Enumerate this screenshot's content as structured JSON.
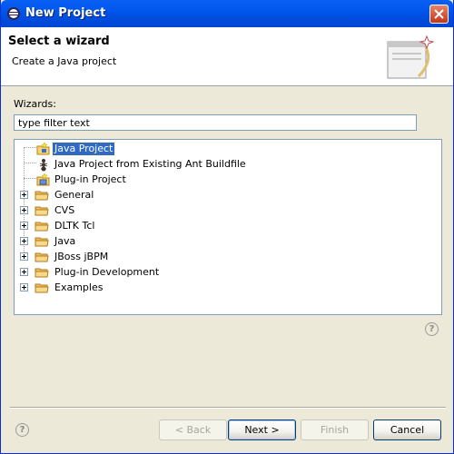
{
  "window": {
    "title": "New Project"
  },
  "header": {
    "title": "Select a wizard",
    "description": "Create a Java project"
  },
  "wizards": {
    "label": "Wizards:",
    "filter_value": "type filter text"
  },
  "tree": {
    "items": [
      {
        "label": "Java Project",
        "icon": "java-project-icon",
        "selected": true,
        "child": true
      },
      {
        "label": "Java Project from Existing Ant Buildfile",
        "icon": "ant-icon",
        "child": true
      },
      {
        "label": "Plug-in Project",
        "icon": "plugin-project-icon",
        "child": true
      },
      {
        "label": "General",
        "icon": "folder-icon"
      },
      {
        "label": "CVS",
        "icon": "folder-icon"
      },
      {
        "label": "DLTK Tcl",
        "icon": "folder-icon"
      },
      {
        "label": "Java",
        "icon": "folder-icon"
      },
      {
        "label": "JBoss jBPM",
        "icon": "folder-icon"
      },
      {
        "label": "Plug-in Development",
        "icon": "folder-icon"
      },
      {
        "label": "Examples",
        "icon": "folder-icon"
      }
    ]
  },
  "buttons": {
    "back": "< Back",
    "next": "Next >",
    "finish": "Finish",
    "cancel": "Cancel"
  },
  "colors": {
    "titlebar": "#0058ee",
    "selection": "#316ac5",
    "dialog_bg": "#ece9d8"
  }
}
